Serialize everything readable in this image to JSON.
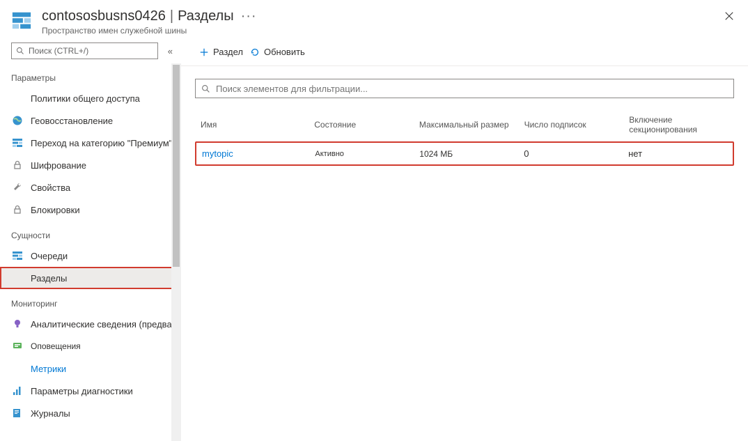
{
  "header": {
    "resource_name": "contososbusns0426",
    "separator": "|",
    "section": "Разделы",
    "ellipsis": "···",
    "description": "Пространство имен служебной шины"
  },
  "sidebar": {
    "search_placeholder": "Поиск (CTRL+/)",
    "groups": [
      {
        "title": "Параметры",
        "items": [
          {
            "label": "Политики общего доступа",
            "icon": "none"
          },
          {
            "label": "Геовосстановление",
            "icon": "globe"
          },
          {
            "label": "Переход на категорию \"Премиум\"",
            "icon": "servicebus"
          },
          {
            "label": "Шифрование",
            "icon": "lock"
          },
          {
            "label": "Свойства",
            "icon": "wrench"
          },
          {
            "label": "Блокировки",
            "icon": "lock"
          }
        ]
      },
      {
        "title": "Сущности",
        "items": [
          {
            "label": "Очереди",
            "icon": "servicebus"
          },
          {
            "label": "Разделы",
            "icon": "none",
            "selected": true,
            "highlighted": true
          }
        ]
      },
      {
        "title": "Мониторинг",
        "items": [
          {
            "label": "Аналитические сведения (предварительная версия)",
            "icon": "bulb"
          },
          {
            "label": "Оповещения",
            "icon": "alert"
          },
          {
            "label": "Метрики",
            "icon": "none",
            "blue": true
          },
          {
            "label": "Параметры диагностики",
            "icon": "diag"
          },
          {
            "label": "Журналы",
            "icon": "logs"
          }
        ]
      }
    ]
  },
  "toolbar": {
    "add_label": "Раздел",
    "refresh_label": "Обновить"
  },
  "content": {
    "filter_placeholder": "Поиск элементов для фильтрации...",
    "columns": [
      "Имя",
      "Состояние",
      "Максимальный размер",
      "Число подписок",
      "Включение секционирования"
    ],
    "rows": [
      {
        "name": "mytopic",
        "state": "Активно",
        "max_size": "1024 МБ",
        "subscriptions": "0",
        "partitioning": "нет"
      }
    ]
  }
}
